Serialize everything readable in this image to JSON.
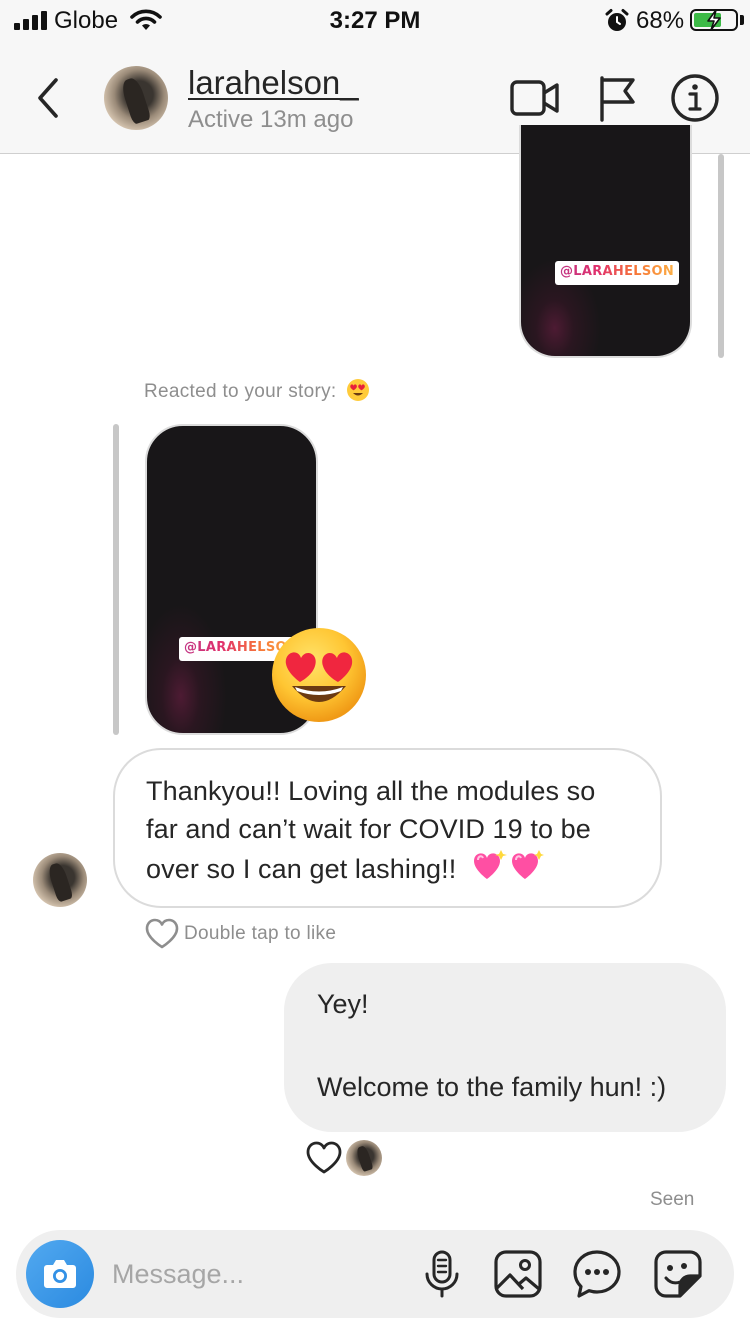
{
  "status_bar": {
    "carrier": "Globe",
    "time": "3:27 PM",
    "battery_percent": "68%",
    "battery_level": 0.68,
    "icons": [
      "signal-icon",
      "wifi-icon",
      "alarm-icon",
      "battery-charging-icon"
    ]
  },
  "header": {
    "username": "larahelson_",
    "active_status": "Active 13m ago",
    "icons": [
      "back-chevron-icon",
      "video-call-icon",
      "flag-icon",
      "info-icon"
    ]
  },
  "messages": {
    "story_tag_top": "@LARAHELSON",
    "reaction_label": "Reacted to your story:",
    "story_tag_mid": "@LARAHELSON",
    "incoming_text": "Thankyou!! Loving all the modules so far and can’t wait for COVID 19 to be over so I can get lashing!!",
    "double_tap_label": "Double tap to like",
    "outgoing_line1": "Yey!",
    "outgoing_line2": "Welcome to the family hun! :)",
    "seen_label": "Seen"
  },
  "composer": {
    "placeholder": "Message...",
    "icons": [
      "camera-icon",
      "microphone-icon",
      "gallery-icon",
      "chat-options-icon",
      "sticker-icon"
    ]
  },
  "colors": {
    "header_bg": "#f7f7f7",
    "camera_blue": "#3797f0",
    "bubble_out_bg": "#efefef",
    "muted_text": "#8e8e8e"
  }
}
